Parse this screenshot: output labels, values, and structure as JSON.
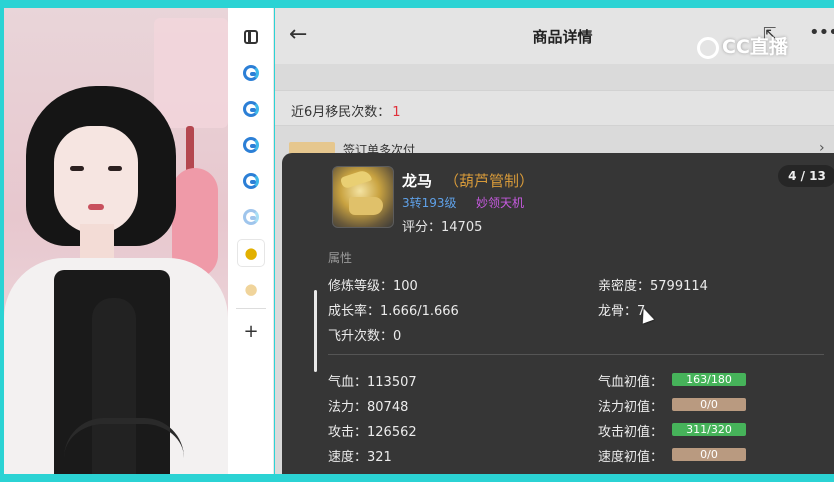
{
  "browser": {
    "title": "商品详情",
    "watermark": "CC直播",
    "faded_rows": {
      "migrate_label": "近6月移民次数：",
      "migrate_value": "1",
      "contract_text": "签订单多次付"
    }
  },
  "sidebar": {
    "icons": [
      "tabs-icon",
      "edge-icon",
      "edge-icon",
      "edge-icon",
      "edge-icon",
      "edge-icon",
      "app-icon",
      "app-icon",
      "add-icon"
    ]
  },
  "pet": {
    "name": "龙马",
    "guard": "（葫芦管制）",
    "level": "3转193级",
    "skill": "妙领天机",
    "score_label": "评分：",
    "score_value": "14705",
    "pager": "4 / 13"
  },
  "attributes": {
    "section_title": "属性",
    "cultivation": "修炼等级：100",
    "intimacy": "亲密度：5799114",
    "growth": "成长率：1.666/1.666",
    "dragon_bone": "龙骨：7",
    "ascend": "飞升次数：0"
  },
  "stats": [
    {
      "label": "气血：113507",
      "init_label": "气血初值：",
      "init_value": "163/180",
      "bar": "full"
    },
    {
      "label": "法力：80748",
      "init_label": "法力初值：",
      "init_value": "0/0",
      "bar": "empty"
    },
    {
      "label": "攻击：126562",
      "init_label": "攻击初值：",
      "init_value": "311/320",
      "bar": "full"
    },
    {
      "label": "速度：321",
      "init_label": "速度初值：",
      "init_value": "0/0",
      "bar": "empty"
    }
  ],
  "colors": {
    "panel_bg": "#363636",
    "level_color": "#5fa1e8",
    "skill_color": "#c75ae0",
    "guard_color": "#d79a3a",
    "bar_full": "#46b35a",
    "bar_empty": "#b99a80"
  }
}
